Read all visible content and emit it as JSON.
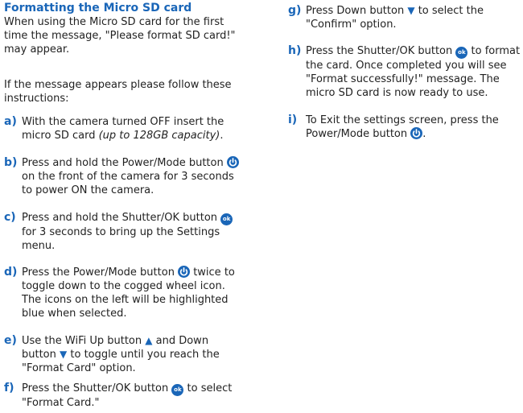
{
  "heading": "Formatting the Micro SD card",
  "intro_1": "When using the Micro SD card for the first time the message, \"Please format SD card!\" may appear.",
  "intro_2": "If the message appears please follow these instructions:",
  "icons": {
    "power": "power-icon",
    "ok": "ok-button-icon",
    "up": "up-triangle-icon",
    "down": "down-triangle-icon",
    "ok_label": "ok",
    "up_glyph": "▲",
    "down_glyph": "▼",
    "accent_color": "#1a66b8"
  },
  "steps": {
    "a": {
      "letter": "a)",
      "text": "With the camera turned OFF insert the micro SD card ",
      "note": "(up to 128GB capacity)",
      "end": "."
    },
    "b": {
      "letter": "b)",
      "pre": "Press and hold the Power/Mode button ",
      "post": " on the front of the camera for 3 seconds to power ON the camera."
    },
    "c": {
      "letter": "c)",
      "pre": "Press and hold the Shutter/OK button ",
      "post": " for 3 seconds to bring up the Settings menu."
    },
    "d": {
      "letter": "d)",
      "pre": "Press the Power/Mode button ",
      "post": " twice to toggle down to the cogged wheel icon. The icons on the left will be highlighted blue when selected."
    },
    "e": {
      "letter": "e)",
      "pre": "Use the WiFi Up button ",
      "mid": " and Down button ",
      "post": " to toggle until you reach the \"Format Card\" option."
    },
    "f": {
      "letter": "f)",
      "pre": "Press the Shutter/OK button ",
      "post": " to select \"Format Card.\""
    },
    "g": {
      "letter": "g)",
      "pre": "Press Down button ",
      "post": " to select the \"Confirm\" option."
    },
    "h": {
      "letter": "h)",
      "pre": "Press the Shutter/OK button ",
      "post": " to format the card. Once completed you will see \"Format successfully!\" message. The micro SD card is now ready to use."
    },
    "i": {
      "letter": "i)",
      "pre": "To Exit the settings screen, press the Power/Mode button ",
      "post": "."
    }
  }
}
